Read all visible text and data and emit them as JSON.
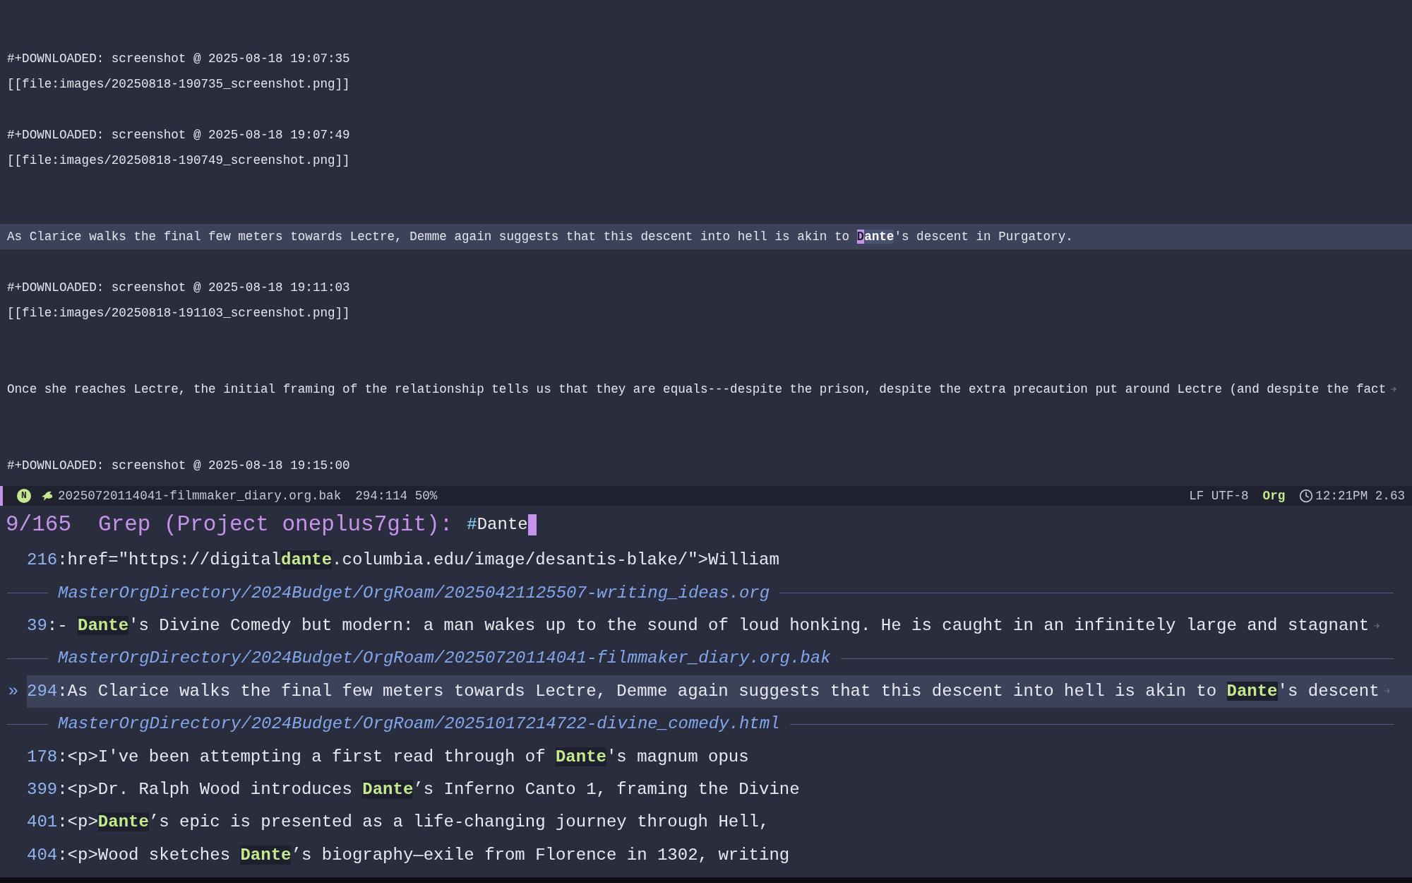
{
  "buffer": {
    "lines": [
      {
        "kind": "text",
        "segments": [
          {
            "kind": "plain",
            "text": "#+DOWNLOADED: screenshot @ 2025-08-18 19:07:35"
          }
        ],
        "current": false,
        "truncated": false
      },
      {
        "kind": "text",
        "segments": [
          {
            "kind": "plain",
            "text": "[[file:images/20250818-190735_screenshot.png]]"
          }
        ],
        "current": false,
        "truncated": false
      },
      {
        "kind": "blank"
      },
      {
        "kind": "text",
        "segments": [
          {
            "kind": "plain",
            "text": "#+DOWNLOADED: screenshot @ 2025-08-18 19:07:49"
          }
        ],
        "current": false,
        "truncated": false
      },
      {
        "kind": "text",
        "segments": [
          {
            "kind": "plain",
            "text": "[[file:images/20250818-190749_screenshot.png]]"
          }
        ],
        "current": false,
        "truncated": false
      },
      {
        "kind": "blank"
      },
      {
        "kind": "blank"
      },
      {
        "kind": "text",
        "segments": [
          {
            "kind": "plain",
            "text": "As Clarice walks the final few meters towards Lectre, Demme again suggests that this descent into hell is akin to "
          },
          {
            "kind": "cursor",
            "text": "D"
          },
          {
            "kind": "match",
            "text": "ante"
          },
          {
            "kind": "plain",
            "text": "'s descent in Purgatory."
          }
        ],
        "current": true,
        "truncated": false
      },
      {
        "kind": "blank"
      },
      {
        "kind": "text",
        "segments": [
          {
            "kind": "plain",
            "text": "#+DOWNLOADED: screenshot @ 2025-08-18 19:11:03"
          }
        ],
        "current": false,
        "truncated": false
      },
      {
        "kind": "text",
        "segments": [
          {
            "kind": "plain",
            "text": "[[file:images/20250818-191103_screenshot.png]]"
          }
        ],
        "current": false,
        "truncated": false
      },
      {
        "kind": "blank"
      },
      {
        "kind": "blank"
      },
      {
        "kind": "text",
        "segments": [
          {
            "kind": "plain",
            "text": "Once she reaches Lectre, the initial framing of the relationship tells us that they are equals---despite the prison, despite the extra precaution put around Lectre (and despite the fact"
          }
        ],
        "current": false,
        "truncated": true
      },
      {
        "kind": "blank"
      },
      {
        "kind": "blank"
      },
      {
        "kind": "text",
        "segments": [
          {
            "kind": "plain",
            "text": "#+DOWNLOADED: screenshot @ 2025-08-18 19:15:00"
          }
        ],
        "current": false,
        "truncated": false
      }
    ]
  },
  "mode_line": {
    "state": "N",
    "file": "20250720114041-filmmaker_diary.org.bak",
    "position": "294:114 50%",
    "encoding": "LF UTF-8",
    "major_mode": "Org",
    "time": "12:21PM 2.63"
  },
  "minibuffer": {
    "count": "9/165",
    "prompt": "Grep (Project oneplus7git):",
    "input_prefix": "#",
    "input": "Dante"
  },
  "selection_marker": "»",
  "results": [
    {
      "kind": "match",
      "line_no": "216",
      "segments": [
        {
          "kind": "plain",
          "text": ":href=\"https://digital"
        },
        {
          "kind": "match",
          "text": "dante"
        },
        {
          "kind": "plain",
          "text": ".columbia.edu/image/desantis-blake/\">William"
        }
      ],
      "selected": false,
      "truncated": false
    },
    {
      "kind": "file",
      "path": "MasterOrgDirectory/2024Budget/OrgRoam/20250421125507-writing_ideas.org"
    },
    {
      "kind": "match",
      "line_no": "39",
      "segments": [
        {
          "kind": "plain",
          "text": ":- "
        },
        {
          "kind": "match",
          "text": "Dante"
        },
        {
          "kind": "plain",
          "text": "'s Divine Comedy but modern: a man wakes up to the sound of loud honking. He is caught in an infinitely large and stagnant"
        }
      ],
      "selected": false,
      "truncated": true
    },
    {
      "kind": "file",
      "path": "MasterOrgDirectory/2024Budget/OrgRoam/20250720114041-filmmaker_diary.org.bak"
    },
    {
      "kind": "match",
      "line_no": "294",
      "segments": [
        {
          "kind": "plain",
          "text": ":As Clarice walks the final few meters towards Lectre, Demme again suggests that this descent into hell is akin to "
        },
        {
          "kind": "match",
          "text": "Dante"
        },
        {
          "kind": "plain",
          "text": "'s descent"
        }
      ],
      "selected": true,
      "truncated": true
    },
    {
      "kind": "file",
      "path": "MasterOrgDirectory/2024Budget/OrgRoam/20251017214722-divine_comedy.html"
    },
    {
      "kind": "match",
      "line_no": "178",
      "segments": [
        {
          "kind": "plain",
          "text": ":<p>I've been attempting a first read through of "
        },
        {
          "kind": "match",
          "text": "Dante"
        },
        {
          "kind": "plain",
          "text": "'s magnum opus"
        }
      ],
      "selected": false,
      "truncated": false
    },
    {
      "kind": "match",
      "line_no": "399",
      "segments": [
        {
          "kind": "plain",
          "text": ":<p>Dr. Ralph Wood introduces "
        },
        {
          "kind": "match",
          "text": "Dante"
        },
        {
          "kind": "plain",
          "text": "’s Inferno Canto 1, framing the Divine"
        }
      ],
      "selected": false,
      "truncated": false
    },
    {
      "kind": "match",
      "line_no": "401",
      "segments": [
        {
          "kind": "plain",
          "text": ":<p>"
        },
        {
          "kind": "match",
          "text": "Dante"
        },
        {
          "kind": "plain",
          "text": "’s epic is presented as a life-changing journey through Hell,"
        }
      ],
      "selected": false,
      "truncated": false
    },
    {
      "kind": "match",
      "line_no": "404",
      "segments": [
        {
          "kind": "plain",
          "text": ":<p>Wood sketches "
        },
        {
          "kind": "match",
          "text": "Dante"
        },
        {
          "kind": "plain",
          "text": "’s biography—exile from Florence in 1302, writing"
        }
      ],
      "selected": false,
      "truncated": false
    }
  ]
}
